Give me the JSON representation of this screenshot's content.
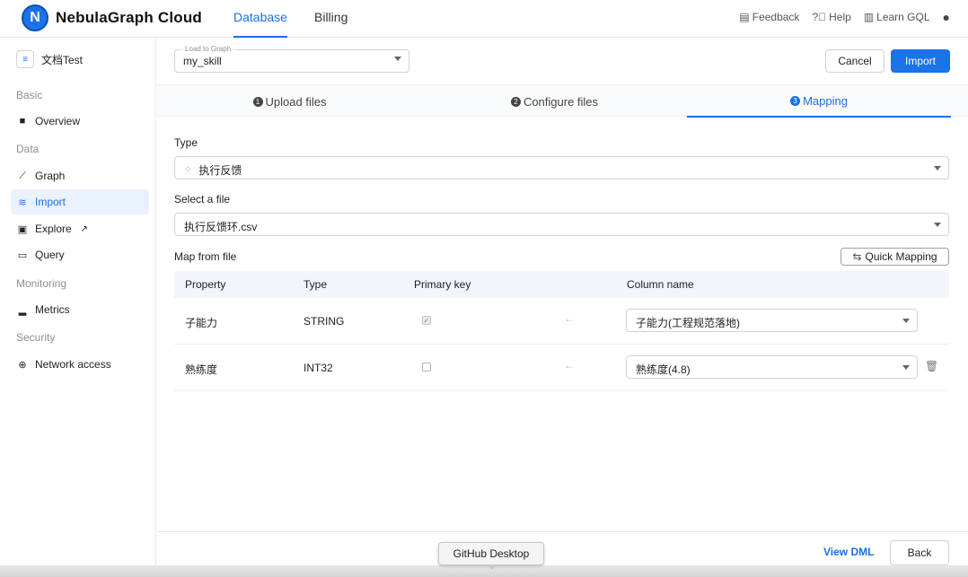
{
  "header": {
    "logo_letter": "N",
    "brand": "NebulaGraph Cloud",
    "tabs": [
      {
        "label": "Database",
        "active": true
      },
      {
        "label": "Billing",
        "active": false
      }
    ],
    "links": {
      "feedback": "Feedback",
      "help": "Help",
      "learn": "Learn GQL"
    }
  },
  "sidebar": {
    "db_name": "文档Test",
    "sections": {
      "basic": "Basic",
      "data": "Data",
      "monitoring": "Monitoring",
      "security": "Security"
    },
    "items": {
      "overview": "Overview",
      "graph": "Graph",
      "import": "Import",
      "explore": "Explore",
      "query": "Query",
      "metrics": "Metrics",
      "network": "Network access"
    }
  },
  "toolbar": {
    "load_label": "Load to Graph",
    "load_value": "my_skill",
    "cancel": "Cancel",
    "import": "Import"
  },
  "steps": [
    {
      "num": "1",
      "label": "Upload files",
      "active": false
    },
    {
      "num": "2",
      "label": "Configure files",
      "active": false
    },
    {
      "num": "3",
      "label": "Mapping",
      "active": true
    }
  ],
  "form": {
    "type_label": "Type",
    "type_value": "执行反馈",
    "file_label": "Select a file",
    "file_value": "执行反馈环.csv",
    "map_label": "Map from file",
    "quick_mapping": "Quick Mapping"
  },
  "table": {
    "headers": {
      "property": "Property",
      "type": "Type",
      "primary": "Primary key",
      "column": "Column name"
    },
    "rows": [
      {
        "property": "子能力",
        "type": "STRING",
        "primary": true,
        "column": "子能力(工程规范落地)"
      },
      {
        "property": "熟练度",
        "type": "INT32",
        "primary": false,
        "column": "熟练度(4.8)"
      }
    ]
  },
  "footer": {
    "view_dml": "View DML",
    "back": "Back"
  },
  "tooltip": "GitHub Desktop",
  "colors": {
    "accent": "#1a73e8",
    "active_bg": "#eaf2ff"
  }
}
